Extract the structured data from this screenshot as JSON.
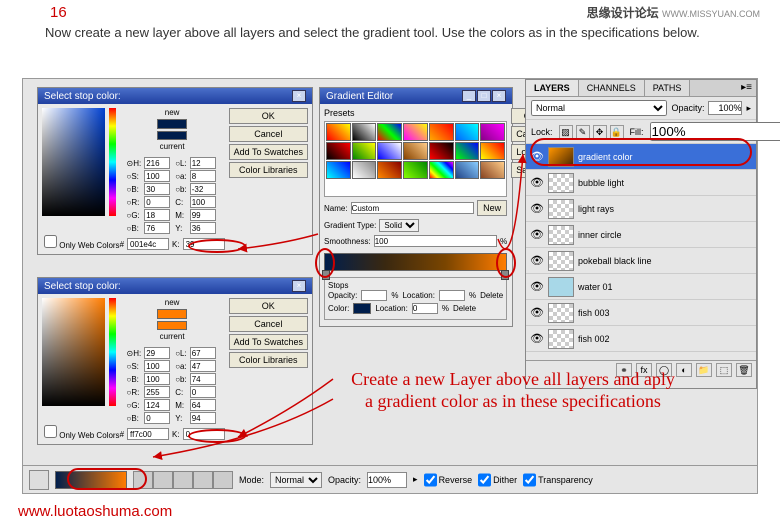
{
  "step": {
    "number": "16",
    "text": "Now create a new layer above all layers and select the gradient tool. Use the colors as in the specifications below."
  },
  "watermark": {
    "top_main": "思缘设计论坛",
    "top_sub": "WWW.MISSYUAN.COM",
    "bottom": "www.luotaoshuma.com"
  },
  "picker": {
    "title": "Select stop color:",
    "new_label": "new",
    "current_label": "current",
    "btn_ok": "OK",
    "btn_cancel": "Cancel",
    "btn_add": "Add To Swatches",
    "btn_lib": "Color Libraries",
    "web_colors": "Only Web Colors",
    "p1": {
      "H": "216",
      "S": "100",
      "B": "30",
      "R": "0",
      "G": "18",
      "B2": "76",
      "L": "12",
      "a": "8",
      "b": "-32",
      "C": "100",
      "M": "99",
      "Y": "36",
      "K": "39",
      "hex": "001e4c"
    },
    "p2": {
      "H": "29",
      "S": "100",
      "B": "100",
      "R": "255",
      "G": "124",
      "B2": "0",
      "L": "67",
      "a": "47",
      "b": "74",
      "C": "0",
      "M": "64",
      "Y": "94",
      "K": "0",
      "hex": "ff7c00"
    }
  },
  "gradient": {
    "title": "Gradient Editor",
    "presets": "Presets",
    "name_label": "Name:",
    "name_value": "Custom",
    "btn_new": "New",
    "type_label": "Gradient Type:",
    "type_value": "Solid",
    "smooth_label": "Smoothness:",
    "smooth_value": "100",
    "pct": "%",
    "stops": "Stops",
    "opacity": "Opacity:",
    "location": "Location:",
    "location_val": "0",
    "color": "Color:",
    "delete": "Delete",
    "btn_ok": "OK",
    "btn_cancel": "Cancel",
    "btn_load": "Load...",
    "btn_save": "Save..."
  },
  "layers": {
    "tab1": "LAYERS",
    "tab2": "CHANNELS",
    "tab3": "PATHS",
    "blend": "Normal",
    "opacity_label": "Opacity:",
    "opacity_val": "100%",
    "lock_label": "Lock:",
    "fill_label": "Fill:",
    "fill_val": "100%",
    "items": [
      {
        "name": "gradient color",
        "sel": true,
        "thumb": "grad"
      },
      {
        "name": "bubble light",
        "thumb": "checker"
      },
      {
        "name": "light rays",
        "thumb": "checker"
      },
      {
        "name": "inner circle",
        "thumb": "checker"
      },
      {
        "name": "pokeball black line",
        "thumb": "checker"
      },
      {
        "name": "water 01",
        "thumb": "water"
      },
      {
        "name": "fish 003",
        "thumb": "checker"
      },
      {
        "name": "fish 002",
        "thumb": "checker"
      }
    ]
  },
  "optbar": {
    "mode": "Mode:",
    "mode_val": "Normal",
    "opacity": "Opacity:",
    "opacity_val": "100%",
    "reverse": "Reverse",
    "dither": "Dither",
    "trans": "Transparency"
  },
  "annotation": "Create a new Layer above all layers and aply\na gradient color as in these specifications"
}
